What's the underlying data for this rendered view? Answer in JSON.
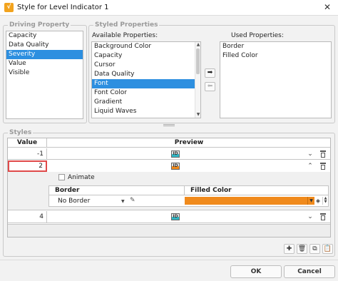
{
  "window": {
    "title": "Style for Level Indicator 1",
    "icon_glyph": "√"
  },
  "driving_property": {
    "group_title": "Driving Property",
    "items": [
      "Capacity",
      "Data Quality",
      "Severity",
      "Value",
      "Visible"
    ],
    "selected": "Severity"
  },
  "styled_properties": {
    "group_title": "Styled Properties",
    "available_label": "Available Properties:",
    "available_items": [
      "Background Color",
      "Capacity",
      "Cursor",
      "Data Quality",
      "Font",
      "Font Color",
      "Gradient",
      "Liquid Waves"
    ],
    "available_selected": "Font",
    "used_label": "Used Properties:",
    "used_items": [
      "Border",
      "Filled Color"
    ],
    "add_arrow": "➡",
    "remove_arrow": "⬅"
  },
  "styles": {
    "group_title": "Styles",
    "columns": {
      "value": "Value",
      "preview": "Preview"
    },
    "preview_glyph": "ID",
    "rows": [
      {
        "value": "-1",
        "preview_color": "#33b6c4",
        "expanded": false
      },
      {
        "value": "2",
        "preview_color": "#f08a1c",
        "expanded": true
      },
      {
        "value": "4",
        "preview_color": "#33b6c4",
        "expanded": false
      }
    ],
    "expanded_editor": {
      "animate_label": "Animate",
      "animate_checked": false,
      "border_header": "Border",
      "filled_color_header": "Filled Color",
      "border_value": "No Border",
      "filled_color_value": "#f08a1c"
    }
  },
  "toolbar_icons": [
    "add-icon",
    "delete-icon",
    "duplicate-icon",
    "clipboard-icon"
  ],
  "buttons": {
    "ok": "OK",
    "cancel": "Cancel"
  }
}
